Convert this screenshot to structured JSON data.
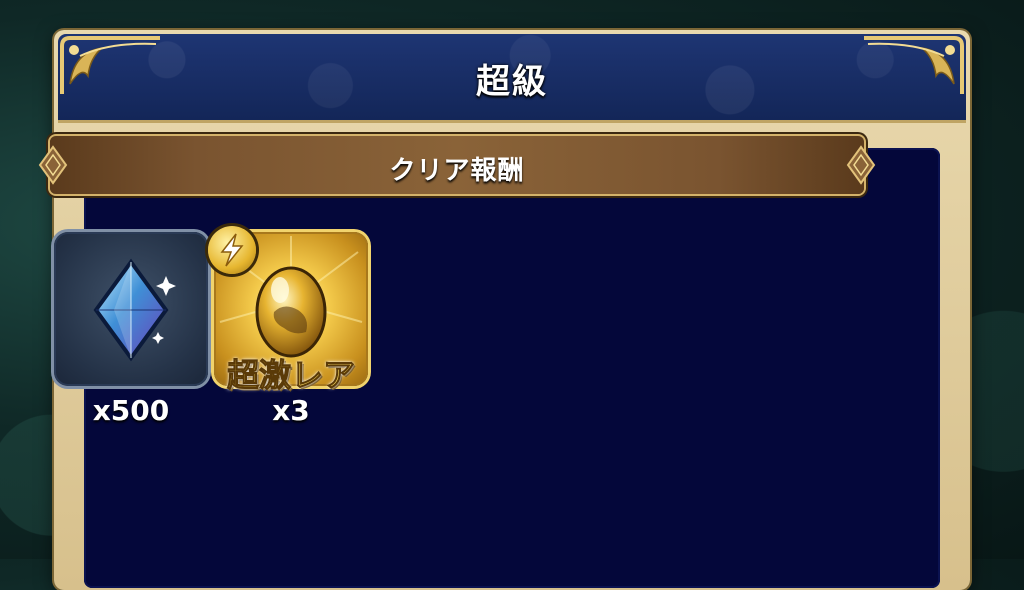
{
  "header": {
    "title": "超級"
  },
  "rewards_section": {
    "banner_label": "クリア報酬",
    "items": [
      {
        "icon": "blue-crystal-icon",
        "quantity": "x500"
      },
      {
        "icon": "golden-egg-icon",
        "badge_icon": "lightning-badge-icon",
        "rarity": "超激レア",
        "quantity": "x3"
      }
    ]
  },
  "colors": {
    "header_blue": "#1e3573",
    "content_navy": "#04073a",
    "frame_gold": "#d4b26a",
    "banner_brown": "#7a5430"
  }
}
